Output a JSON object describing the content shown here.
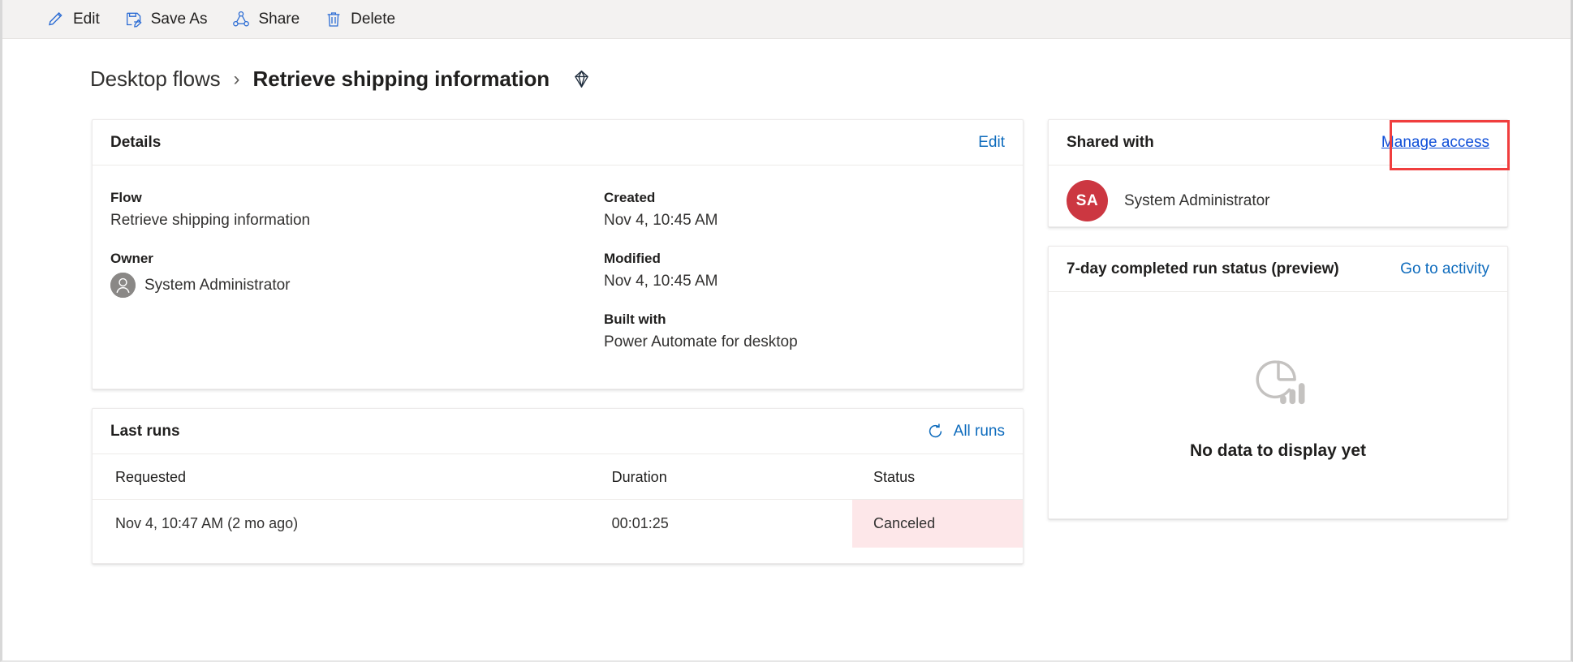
{
  "commandbar": {
    "items": [
      {
        "label": "Edit",
        "icon": "pencil-icon"
      },
      {
        "label": "Save As",
        "icon": "save-as-icon"
      },
      {
        "label": "Share",
        "icon": "share-icon"
      },
      {
        "label": "Delete",
        "icon": "trash-icon"
      }
    ]
  },
  "header": {
    "breadcrumb_parent": "Desktop flows",
    "breadcrumb_separator": "›",
    "breadcrumb_current": "Retrieve shipping information",
    "premium_icon": "gem-icon"
  },
  "details": {
    "title": "Details",
    "edit_label": "Edit",
    "flow_label": "Flow",
    "flow_value": "Retrieve shipping information",
    "owner_label": "Owner",
    "owner_value": "System Administrator",
    "created_label": "Created",
    "created_value": "Nov 4, 10:45 AM",
    "modified_label": "Modified",
    "modified_value": "Nov 4, 10:45 AM",
    "built_with_label": "Built with",
    "built_with_value": "Power Automate for desktop"
  },
  "last_runs": {
    "title": "Last runs",
    "all_runs_label": "All runs",
    "refresh_icon": "refresh-icon",
    "columns": [
      "Requested",
      "Duration",
      "Status"
    ],
    "rows": [
      {
        "requested": "Nov 4, 10:47 AM (2 mo ago)",
        "duration": "00:01:25",
        "status": "Canceled",
        "status_bg": "#fde7e9"
      }
    ]
  },
  "shared_with": {
    "title": "Shared with",
    "manage_access_label": "Manage access",
    "people": [
      {
        "initials": "SA",
        "name": "System Administrator",
        "avatar_color": "#cc3741"
      }
    ]
  },
  "run_status": {
    "title": "7-day completed run status (preview)",
    "go_to_activity_label": "Go to activity",
    "empty_icon": "pie-bar-chart-icon",
    "empty_text": "No data to display yet"
  },
  "colors": {
    "accent_link": "#0f6cbd",
    "highlight_outline": "#f03e3e",
    "toolbar_bg": "#f3f2f1",
    "status_canceled_bg": "#fde7e9"
  }
}
